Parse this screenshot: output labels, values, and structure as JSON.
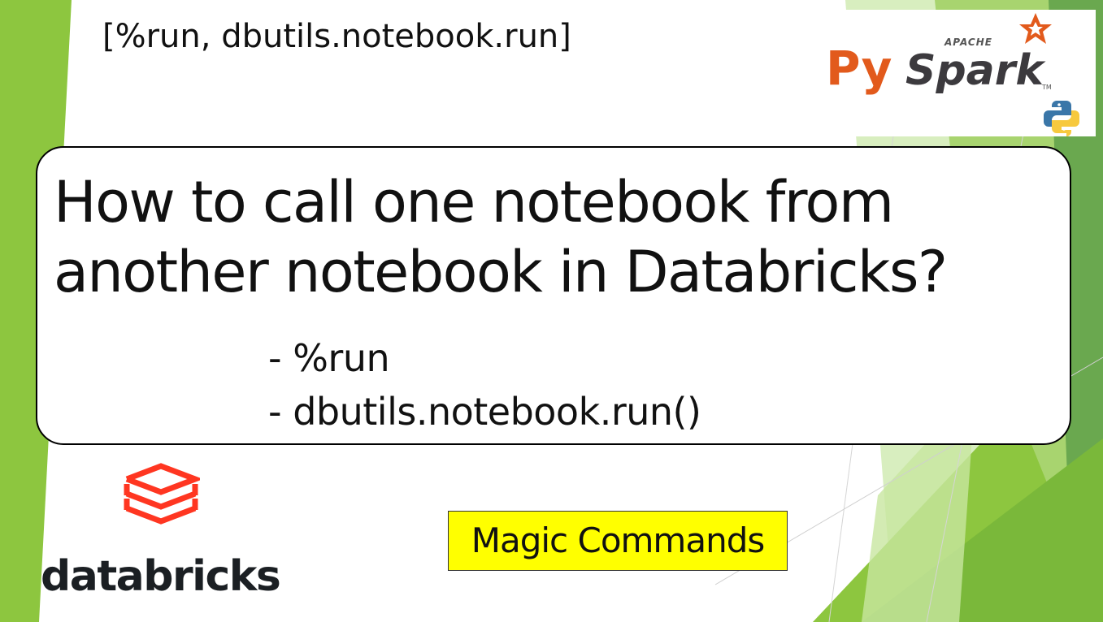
{
  "theme": {
    "accent_green": "#8dc63f",
    "light_green": "#c8e6a0",
    "dark_green": "#6aa84f",
    "badge_yellow": "#ffff00",
    "databricks_red": "#ff3621",
    "pyspark_orange": "#e25a1c"
  },
  "header": {
    "tag": "[%run, dbutils.notebook.run]"
  },
  "pyspark_logo": {
    "apache_label": "APACHE",
    "py_label": "Py",
    "spark_label": "Spark",
    "tm_label": "TM",
    "icons": [
      "spark-star-icon",
      "python-icon"
    ]
  },
  "main_card": {
    "title_line1": "How to call one notebook from",
    "title_line2": "another notebook in Databricks?",
    "methods": [
      "- %run",
      "- dbutils.notebook.run()"
    ]
  },
  "databricks_logo": {
    "wordmark": "databricks",
    "icon": "databricks-stack-icon"
  },
  "badge": {
    "label": "Magic Commands"
  }
}
